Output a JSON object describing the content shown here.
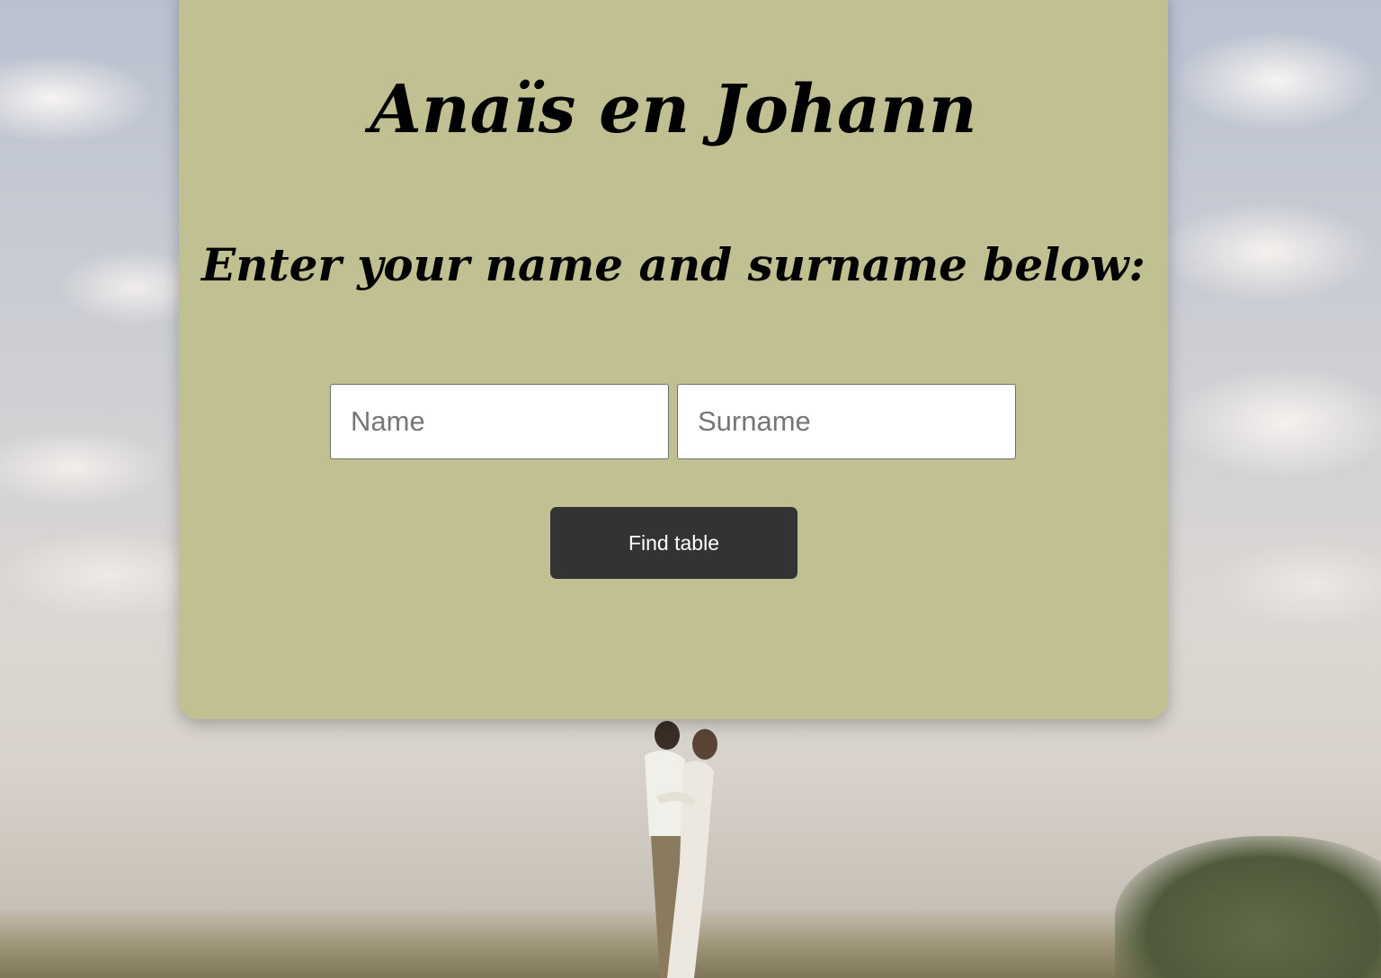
{
  "page": {
    "title": "Anaïs en Johann",
    "instruction": "Enter your name and surname below:"
  },
  "form": {
    "name_placeholder": "Name",
    "surname_placeholder": "Surname",
    "submit_label": "Find table"
  },
  "colors": {
    "card_background": "#c0c092",
    "button_background": "#333333",
    "button_text": "#ffffff",
    "heading_text": "#000000"
  },
  "background": {
    "image": "couple-kissing-on-grassy-hill-under-cloudy-sky"
  }
}
